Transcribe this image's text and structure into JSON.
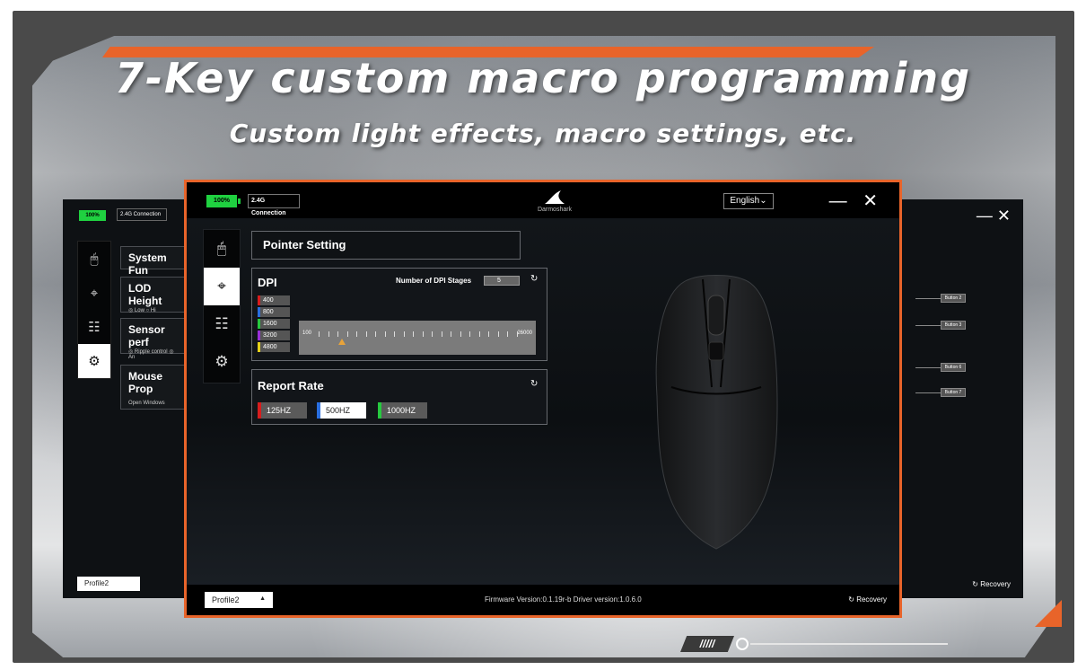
{
  "headline": "7-Key custom macro programming",
  "subheadline": "Custom light effects, macro settings, etc.",
  "back_window": {
    "battery": "100%",
    "connection": "2.4G Connection",
    "window_controls": "— ✕",
    "sections": [
      {
        "label": "System Fun"
      },
      {
        "label": "LOD Height",
        "sub": "◎ Low    ○ Hi"
      },
      {
        "label": "Sensor perf",
        "sub": "◎ Ripple control ◎ An"
      },
      {
        "label": "Mouse Prop",
        "sub": "Open Windows"
      }
    ],
    "button_tags": [
      "Button 2",
      "Button 3",
      "Button 6",
      "Button 7"
    ],
    "profile": "Profile2",
    "recovery": "Recovery"
  },
  "main_window": {
    "battery": "100%",
    "connection": "2.4G Connection",
    "logo_text": "Darmoshark",
    "language": "English",
    "window_controls": "— ✕",
    "pointer_setting": "Pointer Setting",
    "dpi": {
      "title": "DPI",
      "stages_label": "Number of DPI Stages",
      "stages_value": "5",
      "stages": [
        {
          "value": "400",
          "color": "#d71d1d"
        },
        {
          "value": "800",
          "color": "#2a6fe0"
        },
        {
          "value": "1600",
          "color": "#27c93f"
        },
        {
          "value": "3200",
          "color": "#9b30d9"
        },
        {
          "value": "4800",
          "color": "#e6d21a"
        }
      ],
      "slider_min": "100",
      "slider_max": "26000"
    },
    "report_rate": {
      "title": "Report Rate",
      "options": [
        {
          "label": "125HZ",
          "color": "#d71d1d",
          "selected": false
        },
        {
          "label": "500HZ",
          "color": "#2a6fe0",
          "selected": true
        },
        {
          "label": "1000HZ",
          "color": "#27c93f",
          "selected": false
        }
      ]
    },
    "profile": "Profile2",
    "firmware": "Firmware Version:0.1.19r-b  Driver version:1.0.6.0",
    "recovery": "Recovery"
  },
  "deco_slashes": "/////"
}
